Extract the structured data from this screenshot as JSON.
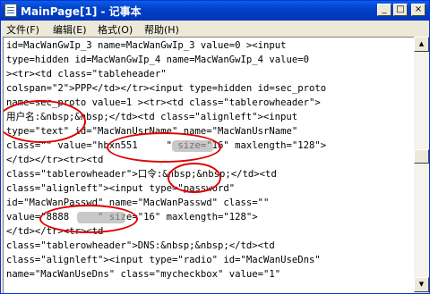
{
  "window": {
    "title": "MainPage[1] - 记事本"
  },
  "title_buttons": {
    "minimize": "_",
    "maximize": "□",
    "close": "×"
  },
  "menu": [
    "文件(F)",
    "编辑(E)",
    "格式(O)",
    "帮助(H)"
  ],
  "editor_lines": [
    "id=MacWanGwIp_3 name=MacWanGwIp_3 value=0 ><input",
    "type=hidden id=MacWanGwIp_4 name=MacWanGwIp_4 value=0",
    "><tr><td class=\"tableheader\"",
    "colspan=\"2\">PPP</td></tr><input type=hidden id=sec_proto",
    "name=sec_proto value=1 ><tr><td class=\"tablerowheader\">",
    "用户名:&nbsp;&nbsp;</td><td class=\"alignleft\"><input",
    "type=\"text\" id=\"MacWanUsrName\" name=\"MacWanUsrName\"",
    "class=\"\" value=\"hbxn551     \" size=\"16\" maxlength=\"128\">",
    "</td></tr><tr><td",
    "class=\"tablerowheader\">口令:&nbsp;&nbsp;</td><td",
    "class=\"alignleft\"><input type=\"password\"",
    "id=\"MacWanPasswd\" name=\"MacWanPasswd\" class=\"\"",
    "value=\"8888     \" size=\"16\" maxlength=\"128\">",
    "</td></tr><tr><td",
    "class=\"tablerowheader\">DNS:&nbsp;&nbsp;</td><td",
    "class=\"alignleft\"><input type=\"radio\" id=\"MacWanUseDns\"",
    "name=\"MacWanUseDns\" class=\"mycheckbox\" value=\"1\""
  ],
  "scrollbar": {
    "position": 0.46
  }
}
